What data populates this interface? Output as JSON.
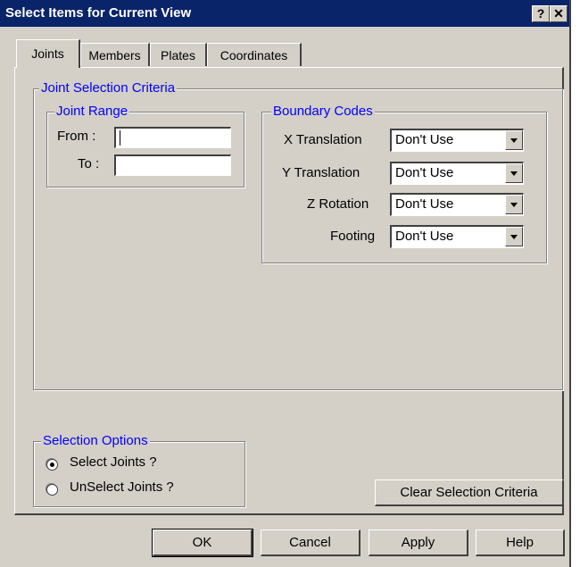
{
  "window": {
    "title": "Select Items for Current View",
    "help_button": "?",
    "close_button": "✕"
  },
  "tabs": [
    {
      "label": "Joints",
      "active": true
    },
    {
      "label": "Members"
    },
    {
      "label": "Plates"
    },
    {
      "label": "Coordinates"
    }
  ],
  "criteria": {
    "title": "Joint Selection Criteria",
    "range": {
      "title": "Joint Range",
      "from_label": "From :",
      "from_value": "",
      "to_label": "To :",
      "to_value": ""
    },
    "boundary": {
      "title": "Boundary Codes",
      "rows": [
        {
          "label": "X Translation",
          "value": "Don't Use"
        },
        {
          "label": "Y Translation",
          "value": "Don't Use"
        },
        {
          "label": "Z Rotation",
          "value": "Don't Use"
        },
        {
          "label": "Footing",
          "value": "Don't Use"
        }
      ]
    }
  },
  "selection_options": {
    "title": "Selection Options",
    "select_label": "Select Joints ?",
    "unselect_label": "UnSelect Joints ?",
    "selected": "select"
  },
  "clear_button": "Clear Selection Criteria",
  "footer": {
    "ok": "OK",
    "cancel": "Cancel",
    "apply": "Apply",
    "help": "Help"
  }
}
